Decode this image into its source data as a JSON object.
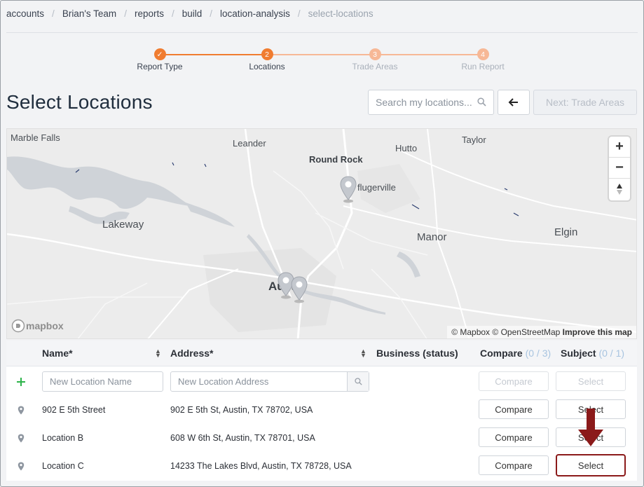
{
  "breadcrumb": {
    "items": [
      "accounts",
      "Brian's Team",
      "reports",
      "build",
      "location-analysis"
    ],
    "current": "select-locations"
  },
  "stepper": {
    "steps": [
      {
        "label": "Report Type",
        "number": "✓",
        "state": "done"
      },
      {
        "label": "Locations",
        "number": "2",
        "state": "active"
      },
      {
        "label": "Trade Areas",
        "number": "3",
        "state": "pending"
      },
      {
        "label": "Run Report",
        "number": "4",
        "state": "pending"
      }
    ],
    "colors": {
      "active": "#f07c30",
      "pending": "#f7b896"
    }
  },
  "page": {
    "title": "Select Locations",
    "search_placeholder": "Search my locations...",
    "next_label": "Next: Trade Areas"
  },
  "map": {
    "places": {
      "marble_falls": "Marble Falls",
      "leander": "Leander",
      "taylor": "Taylor",
      "round_rock": "Round Rock",
      "hutto": "Hutto",
      "pflugerville": "flugerville",
      "lakeway": "Lakeway",
      "elgin": "Elgin",
      "manor": "Manor",
      "austin": "Austin"
    },
    "zoom_in": "+",
    "zoom_out": "−",
    "compass": "▲",
    "logo_text": "mapbox",
    "attribution": {
      "mapbox": "© Mapbox",
      "osm": "© OpenStreetMap",
      "improve": "Improve this map"
    }
  },
  "table": {
    "headers": {
      "name": "Name*",
      "address": "Address*",
      "business": "Business (status)",
      "compare": "Compare",
      "compare_count": "(0 / 3)",
      "subject": "Subject",
      "subject_count": "(0 / 1)"
    },
    "new_row": {
      "name_placeholder": "New Location Name",
      "address_placeholder": "New Location Address",
      "compare_label": "Compare",
      "select_label": "Select"
    },
    "rows": [
      {
        "name": "902 E 5th Street",
        "address": "902 E 5th St, Austin, TX 78702, USA",
        "compare": "Compare",
        "select": "Select"
      },
      {
        "name": "Location B",
        "address": "608 W 6th St, Austin, TX 78701, USA",
        "compare": "Compare",
        "select": "Select"
      },
      {
        "name": "Location C",
        "address": "14233 The Lakes Blvd, Austin, TX 78728, USA",
        "compare": "Compare",
        "select": "Select"
      }
    ]
  },
  "annotation": {
    "highlight_color": "#8b1a1a"
  }
}
